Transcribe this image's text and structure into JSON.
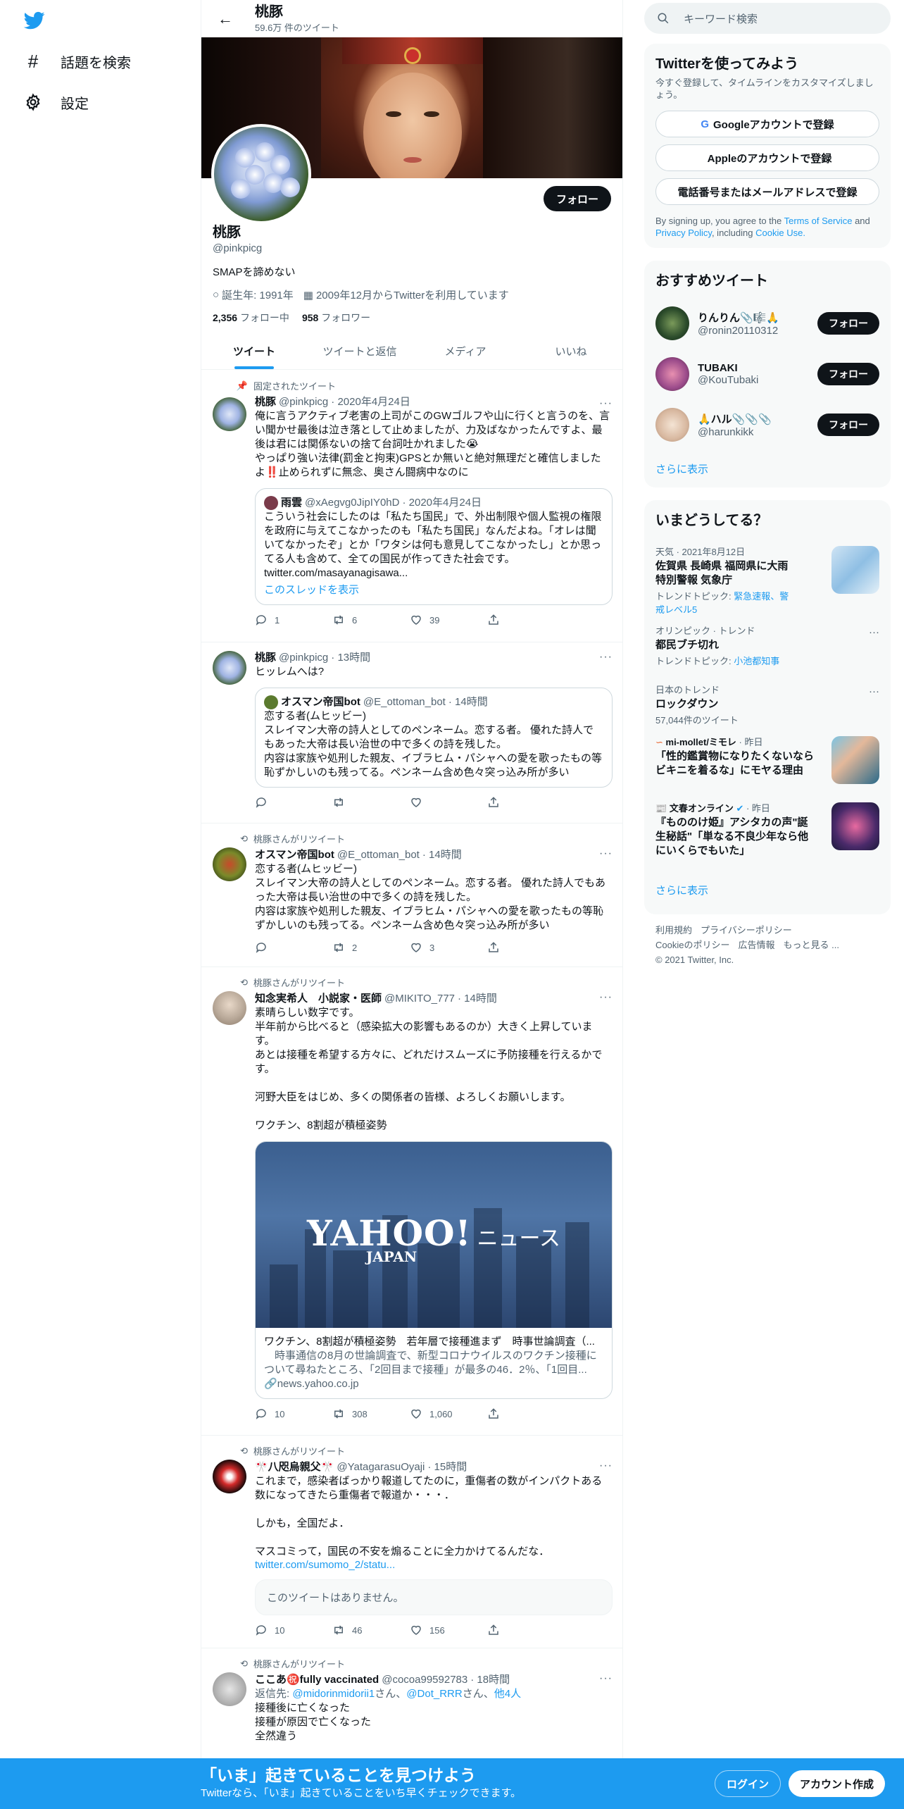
{
  "nav": {
    "explore_label": "話題を検索",
    "settings_label": "設定"
  },
  "header": {
    "name": "桃豚",
    "tweet_count": "59.6万 件のツイート"
  },
  "profile": {
    "follow_label": "フォロー",
    "name": "桃豚",
    "handle": "@pinkpicg",
    "bio": "SMAPを諦めない",
    "birthday": "誕生年: 1991年",
    "joined": "2009年12月からTwitterを利用しています",
    "following_count": "2,356",
    "following_label": "フォロー中",
    "followers_count": "958",
    "followers_label": "フォロワー"
  },
  "tabs": [
    {
      "label": "ツイート"
    },
    {
      "label": "ツイートと返信"
    },
    {
      "label": "メディア"
    },
    {
      "label": "いいね"
    }
  ],
  "tweets": [
    {
      "context": "固定されたツイート",
      "name": "桃豚",
      "handle": "@pinkpicg",
      "time": "· 2020年4月24日",
      "text": "俺に言うアクティブ老害の上司がこのGWゴルフや山に行くと言うのを、言い聞かせ最後は泣き落として止めましたが、力及ばなかったんですよ、最後は君には関係ないの捨て台詞吐かれました😭\nやっぱり強い法律(罰金と拘束)GPSとか無いと絶対無理だと確信しましたよ‼️止められずに無念、奥さん闘病中なのに",
      "quote": {
        "name": "雨雲",
        "handle": "@xAegvg0JipIY0hD",
        "time": "· 2020年4月24日",
        "text": "こういう社会にしたのは「私たち国民」で、外出制限や個人監視の権限を政府に与えてこなかったのも「私たち国民」なんだよね。「オレは聞いてなかったぞ」とか「ワタシは何も意見してこなかったし」とか思ってる人も含めて、全ての国民が作ってきた社会です。\ntwitter.com/masayanagisawa...",
        "thread": "このスレッドを表示"
      },
      "reply": "1",
      "retweet": "6",
      "like": "39"
    },
    {
      "name": "桃豚",
      "handle": "@pinkpicg",
      "time": "· 13時間",
      "text": "ヒッレムへは?",
      "quote": {
        "name": "オスマン帝国bot",
        "handle": "@E_ottoman_bot",
        "time": "· 14時間",
        "text": "恋する者(ムヒッビー)\nスレイマン大帝の詩人としてのペンネーム。恋する者。 優れた詩人でもあった大帝は長い治世の中で多くの詩を残した。\n内容は家族や処刑した親友、イブラヒム・パシャへの愛を歌ったもの等恥ずかしいのも残ってる。ペンネーム含め色々突っ込み所が多い"
      },
      "reply": "",
      "retweet": "",
      "like": ""
    },
    {
      "context": "桃豚さんがリツイート",
      "name": "オスマン帝国bot",
      "handle": "@E_ottoman_bot",
      "time": "· 14時間",
      "text": "恋する者(ムヒッビー)\nスレイマン大帝の詩人としてのペンネーム。恋する者。 優れた詩人でもあった大帝は長い治世の中で多くの詩を残した。\n内容は家族や処刑した親友、イブラヒム・パシャへの愛を歌ったもの等恥ずかしいのも残ってる。ペンネーム含め色々突っ込み所が多い",
      "reply": "",
      "retweet": "2",
      "like": "3"
    },
    {
      "context": "桃豚さんがリツイート",
      "name": "知念実希人　小説家・医師",
      "handle": "@MIKITO_777",
      "time": "· 14時間",
      "text": "素晴らしい数字です。\n半年前から比べると（感染拡大の影響もあるのか）大きく上昇しています。\nあとは接種を希望する方々に、どれだけスムーズに予防接種を行えるかです。\n\n河野大臣をはじめ、多くの関係者の皆様、よろしくお願いします。\n\nワクチン、8割超が積極姿勢",
      "card": {
        "logo_main": "YAHOO!",
        "logo_news": "ニュース",
        "logo_sub": "JAPAN",
        "title": "ワクチン、8割超が積極姿勢　若年層で接種進まず　時事世論調査（...",
        "desc": "　時事通信の8月の世論調査で、新型コロナウイルスのワクチン接種について尋ねたところ、「2回目まで接種」が最多の46．2％、「1回目...",
        "domain": "news.yahoo.co.jp"
      },
      "reply": "10",
      "retweet": "308",
      "like": "1,060"
    },
    {
      "context": "桃豚さんがリツイート",
      "name": "🎌八咫烏親父🎌",
      "handle": "@YatagarasuOyaji",
      "time": "· 15時間",
      "text": "これまで，感染者ばっかり報道してたのに，重傷者の数がインパクトある数になってきたら重傷者で報道か・・・．\n\nしかも，全国だよ．\n\nマスコミって，国民の不安を煽ることに全力かけてるんだな．",
      "link": "twitter.com/sumomo_2/statu...",
      "missing": "このツイートはありません。",
      "reply": "10",
      "retweet": "46",
      "like": "156"
    },
    {
      "context": "桃豚さんがリツイート",
      "name": "ここあ㊗️fully vaccinated",
      "handle": "@cocoa99592783",
      "time": "· 18時間",
      "reply_to_label": "返信先:",
      "reply_to_1": "@midorinmidorii1",
      "reply_to_2": "@Dot_RRR",
      "reply_to_3": "他4人",
      "san": "さん、",
      "text": "接種後に亡くなった\n接種が原因で亡くなった\n全然違う"
    }
  ],
  "right": {
    "search_placeholder": "キーワード検索",
    "signup": {
      "title": "Twitterを使ってみよう",
      "sub": "今すぐ登録して、タイムラインをカスタマイズしましょう。",
      "google": "Googleアカウントで登録",
      "apple": "Appleのアカウントで登録",
      "phone": "電話番号またはメールアドレスで登録",
      "terms_pre": "By signing up, you agree to the",
      "tos": "Terms of Service",
      "and": "and",
      "privacy": "Privacy Policy",
      "including": ", including",
      "cookie": "Cookie Use."
    },
    "recs": {
      "title": "おすすめツイート",
      "follow_label": "フォロー",
      "items": [
        {
          "name": "りんりん📎🎼🙏",
          "handle": "@ronin20110312"
        },
        {
          "name": "TUBAKI",
          "handle": "@KouTubaki"
        },
        {
          "name": "🙏ハル📎📎📎",
          "handle": "@harunkikk"
        }
      ],
      "more": "さらに表示"
    },
    "trends": {
      "title": "いまどうしてる？",
      "items": [
        {
          "cat": "天気 · 2021年8月12日",
          "title": "佐賀県 長崎県 福岡県に大雨特別警報 気象庁",
          "note_pre": "トレンドトピック: ",
          "note_link": "緊急速報、警戒レベル5"
        },
        {
          "cat": "オリンピック · トレンド",
          "title": "都民ブチ切れ",
          "note_pre": "トレンドトピック: ",
          "note_link": "小池都知事"
        },
        {
          "cat": "日本のトレンド",
          "title": "ロックダウン",
          "note": "57,044件のツイート"
        },
        {
          "src": "mi-mollet/ミモレ",
          "time": "· 昨日",
          "title": "「性的鑑賞物になりたくないならビキニを着るな」にモヤる理由"
        },
        {
          "src": "文春オンライン",
          "time": "· 昨日",
          "title": "『もののけ姫』アシタカの声\"誕生秘話\"「単なる不良少年なら他にいくらでもいた」"
        }
      ],
      "more": "さらに表示"
    },
    "footer": {
      "terms": "利用規約",
      "privacy": "プライバシーポリシー",
      "cookie": "Cookieのポリシー",
      "ads": "広告情報",
      "more": "もっと見る ...",
      "copyright": "© 2021 Twitter, Inc."
    }
  },
  "bottom": {
    "title": "「いま」起きていることを見つけよう",
    "sub": "Twitterなら、「いま」起きていることをいち早くチェックできます。",
    "login": "ログイン",
    "signup": "アカウント作成"
  },
  "colors": {
    "accent": "#1d9bf0",
    "text": "#0f1419",
    "muted": "#536471"
  }
}
